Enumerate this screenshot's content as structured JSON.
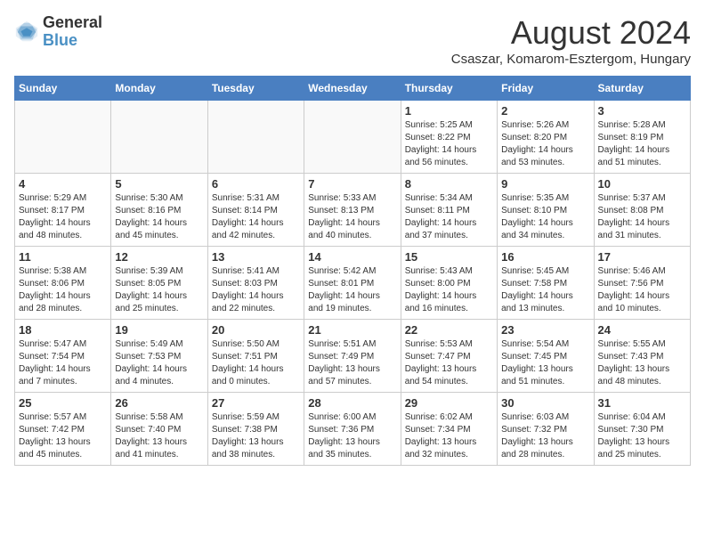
{
  "header": {
    "logo_line1": "General",
    "logo_line2": "Blue",
    "main_title": "August 2024",
    "subtitle": "Csaszar, Komarom-Esztergom, Hungary"
  },
  "weekdays": [
    "Sunday",
    "Monday",
    "Tuesday",
    "Wednesday",
    "Thursday",
    "Friday",
    "Saturday"
  ],
  "weeks": [
    [
      {
        "day": "",
        "info": ""
      },
      {
        "day": "",
        "info": ""
      },
      {
        "day": "",
        "info": ""
      },
      {
        "day": "",
        "info": ""
      },
      {
        "day": "1",
        "info": "Sunrise: 5:25 AM\nSunset: 8:22 PM\nDaylight: 14 hours\nand 56 minutes."
      },
      {
        "day": "2",
        "info": "Sunrise: 5:26 AM\nSunset: 8:20 PM\nDaylight: 14 hours\nand 53 minutes."
      },
      {
        "day": "3",
        "info": "Sunrise: 5:28 AM\nSunset: 8:19 PM\nDaylight: 14 hours\nand 51 minutes."
      }
    ],
    [
      {
        "day": "4",
        "info": "Sunrise: 5:29 AM\nSunset: 8:17 PM\nDaylight: 14 hours\nand 48 minutes."
      },
      {
        "day": "5",
        "info": "Sunrise: 5:30 AM\nSunset: 8:16 PM\nDaylight: 14 hours\nand 45 minutes."
      },
      {
        "day": "6",
        "info": "Sunrise: 5:31 AM\nSunset: 8:14 PM\nDaylight: 14 hours\nand 42 minutes."
      },
      {
        "day": "7",
        "info": "Sunrise: 5:33 AM\nSunset: 8:13 PM\nDaylight: 14 hours\nand 40 minutes."
      },
      {
        "day": "8",
        "info": "Sunrise: 5:34 AM\nSunset: 8:11 PM\nDaylight: 14 hours\nand 37 minutes."
      },
      {
        "day": "9",
        "info": "Sunrise: 5:35 AM\nSunset: 8:10 PM\nDaylight: 14 hours\nand 34 minutes."
      },
      {
        "day": "10",
        "info": "Sunrise: 5:37 AM\nSunset: 8:08 PM\nDaylight: 14 hours\nand 31 minutes."
      }
    ],
    [
      {
        "day": "11",
        "info": "Sunrise: 5:38 AM\nSunset: 8:06 PM\nDaylight: 14 hours\nand 28 minutes."
      },
      {
        "day": "12",
        "info": "Sunrise: 5:39 AM\nSunset: 8:05 PM\nDaylight: 14 hours\nand 25 minutes."
      },
      {
        "day": "13",
        "info": "Sunrise: 5:41 AM\nSunset: 8:03 PM\nDaylight: 14 hours\nand 22 minutes."
      },
      {
        "day": "14",
        "info": "Sunrise: 5:42 AM\nSunset: 8:01 PM\nDaylight: 14 hours\nand 19 minutes."
      },
      {
        "day": "15",
        "info": "Sunrise: 5:43 AM\nSunset: 8:00 PM\nDaylight: 14 hours\nand 16 minutes."
      },
      {
        "day": "16",
        "info": "Sunrise: 5:45 AM\nSunset: 7:58 PM\nDaylight: 14 hours\nand 13 minutes."
      },
      {
        "day": "17",
        "info": "Sunrise: 5:46 AM\nSunset: 7:56 PM\nDaylight: 14 hours\nand 10 minutes."
      }
    ],
    [
      {
        "day": "18",
        "info": "Sunrise: 5:47 AM\nSunset: 7:54 PM\nDaylight: 14 hours\nand 7 minutes."
      },
      {
        "day": "19",
        "info": "Sunrise: 5:49 AM\nSunset: 7:53 PM\nDaylight: 14 hours\nand 4 minutes."
      },
      {
        "day": "20",
        "info": "Sunrise: 5:50 AM\nSunset: 7:51 PM\nDaylight: 14 hours\nand 0 minutes."
      },
      {
        "day": "21",
        "info": "Sunrise: 5:51 AM\nSunset: 7:49 PM\nDaylight: 13 hours\nand 57 minutes."
      },
      {
        "day": "22",
        "info": "Sunrise: 5:53 AM\nSunset: 7:47 PM\nDaylight: 13 hours\nand 54 minutes."
      },
      {
        "day": "23",
        "info": "Sunrise: 5:54 AM\nSunset: 7:45 PM\nDaylight: 13 hours\nand 51 minutes."
      },
      {
        "day": "24",
        "info": "Sunrise: 5:55 AM\nSunset: 7:43 PM\nDaylight: 13 hours\nand 48 minutes."
      }
    ],
    [
      {
        "day": "25",
        "info": "Sunrise: 5:57 AM\nSunset: 7:42 PM\nDaylight: 13 hours\nand 45 minutes."
      },
      {
        "day": "26",
        "info": "Sunrise: 5:58 AM\nSunset: 7:40 PM\nDaylight: 13 hours\nand 41 minutes."
      },
      {
        "day": "27",
        "info": "Sunrise: 5:59 AM\nSunset: 7:38 PM\nDaylight: 13 hours\nand 38 minutes."
      },
      {
        "day": "28",
        "info": "Sunrise: 6:00 AM\nSunset: 7:36 PM\nDaylight: 13 hours\nand 35 minutes."
      },
      {
        "day": "29",
        "info": "Sunrise: 6:02 AM\nSunset: 7:34 PM\nDaylight: 13 hours\nand 32 minutes."
      },
      {
        "day": "30",
        "info": "Sunrise: 6:03 AM\nSunset: 7:32 PM\nDaylight: 13 hours\nand 28 minutes."
      },
      {
        "day": "31",
        "info": "Sunrise: 6:04 AM\nSunset: 7:30 PM\nDaylight: 13 hours\nand 25 minutes."
      }
    ]
  ]
}
